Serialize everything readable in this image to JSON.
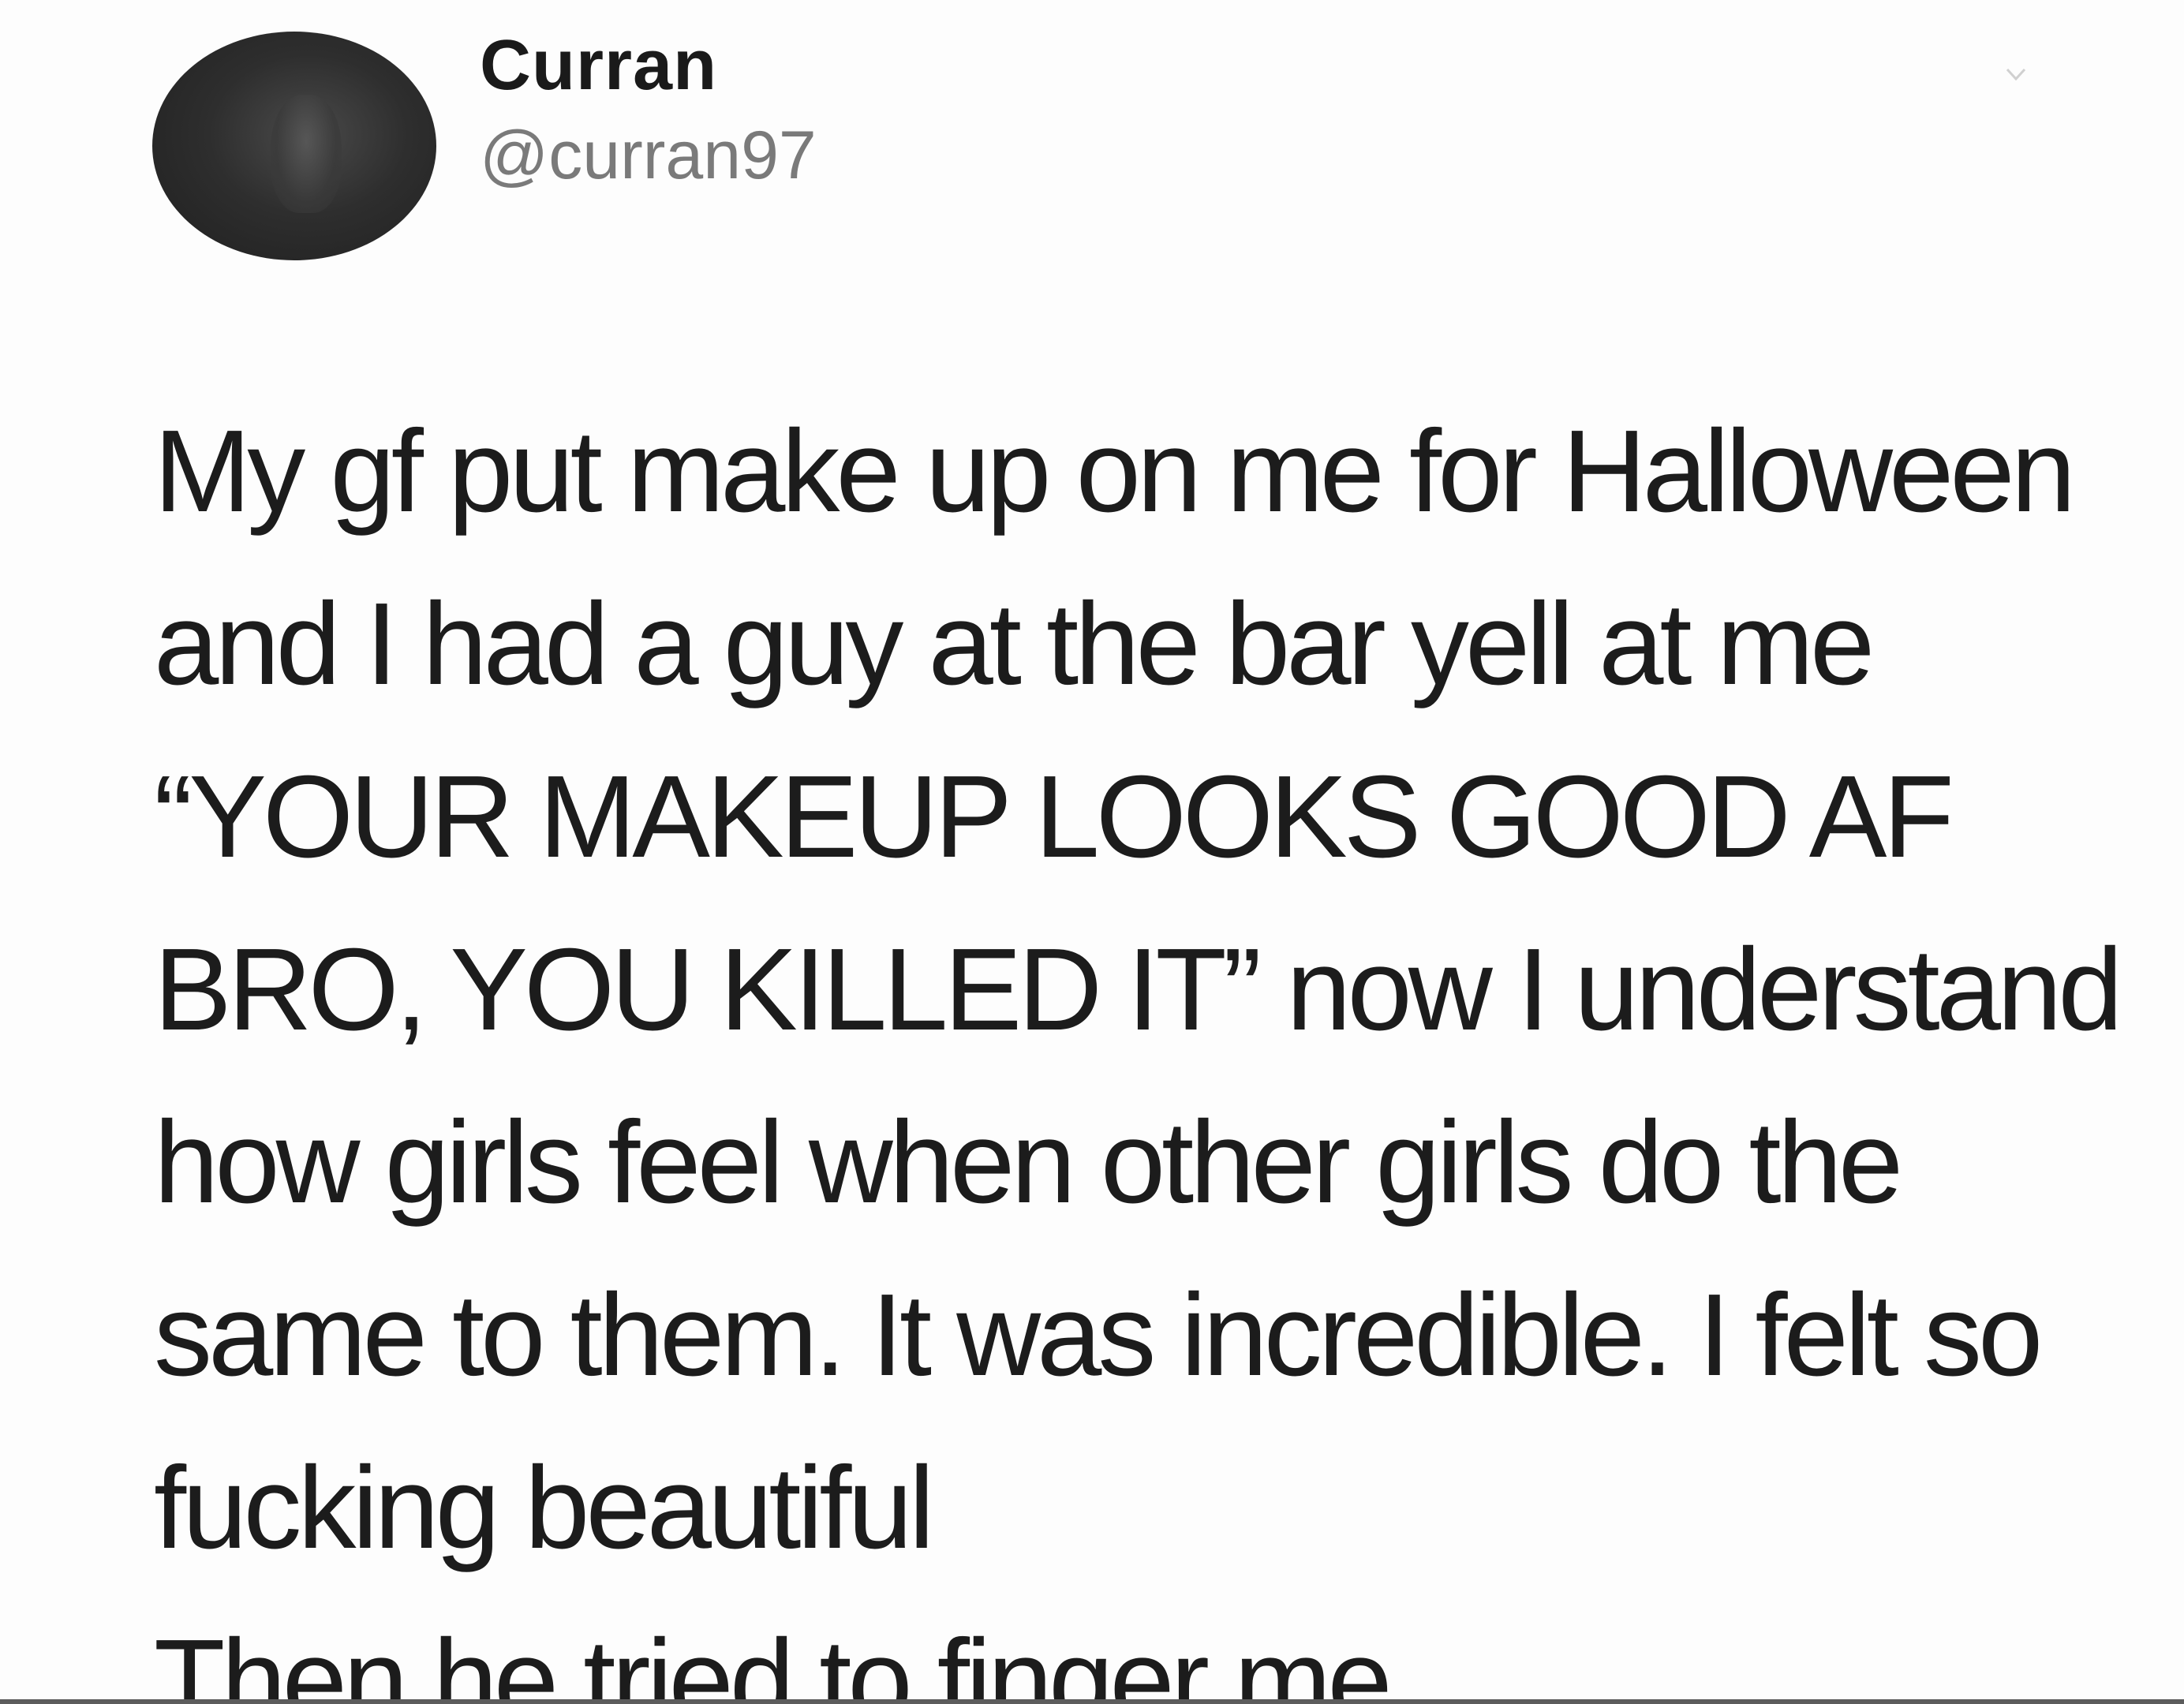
{
  "tweet": {
    "author": {
      "display_name": "Curran",
      "handle": "@curran97"
    },
    "text_lines": [
      "My gf put make up on me for Halloween",
      "and I had a guy at the bar yell at me",
      "“YOUR MAKEUP LOOKS GOOD AF",
      "BRO, YOU KILLED IT” now I understand",
      "how girls feel when other girls do the",
      "same to them. It was incredible. I felt so",
      "fucking beautiful",
      "Then he tried to finger me"
    ],
    "icons": {
      "avatar": "profile-photo",
      "more": "chevron-down-icon"
    }
  }
}
